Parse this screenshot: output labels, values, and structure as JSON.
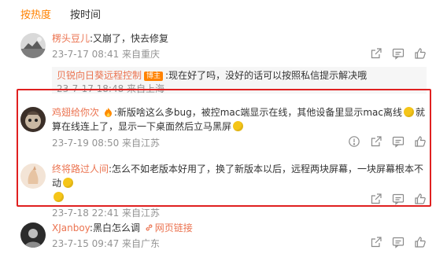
{
  "tabs": {
    "hot": "按热度",
    "time": "按时间"
  },
  "colors": {
    "accent": "#ff8200",
    "username": "#eb7350",
    "highlight_border": "#e02020"
  },
  "comments": [
    {
      "username": "楞头豆儿",
      "text": ":又崩了，快去修复",
      "meta": "23-7-17 08:41 来自重庆",
      "reply": {
        "username": "贝锐向日葵远程控制",
        "badge": "博主",
        "text": ":现在好了吗，没好的话可以按照私信提示解决哦",
        "meta": "23-7-17 18:48 来自上海"
      }
    },
    {
      "username": "鸡翅给你次",
      "text_a": ":新版啥这么多bug，被控mac端显示在线，其他设备里显示mac离线",
      "text_b": "就算在线连上了，显示一下桌面然后立马黑屏",
      "meta": "23-7-19 08:50 来自江苏"
    },
    {
      "username": "终将路过人间",
      "text": ":怎么不如老版本好用了，换了新版本以后，远程两块屏幕，一块屏幕根本不动",
      "meta": "23-7-18 22:41 来自江苏"
    },
    {
      "username": "XJanboy",
      "text": ":黑白怎么调",
      "link_text": "网页链接",
      "meta": "23-7-15 09:47 来自广东"
    }
  ],
  "icons": [
    "share-icon",
    "comment-icon",
    "like-icon",
    "report-icon",
    "link-icon",
    "emoji-icon",
    "fire-icon"
  ]
}
